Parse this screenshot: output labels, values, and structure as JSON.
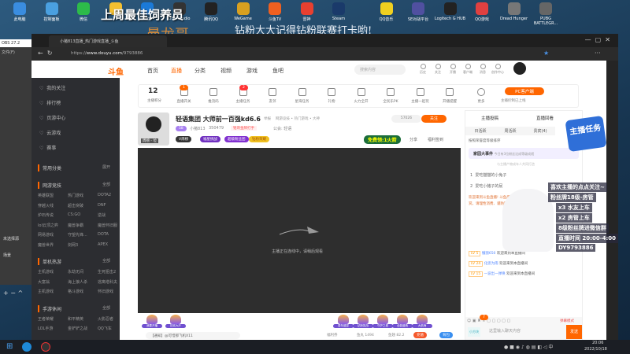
{
  "desktop": {
    "icons": [
      "此电脑",
      "控制面板",
      "微信",
      "YY",
      "Edge",
      "OBS Studio",
      "腾讯QQ",
      "WeGame",
      "斗鱼TV",
      "雷神",
      "Steam",
      "QQ音乐",
      "SE对战平台",
      "Logitech G HUB",
      "QQ游戏",
      "Dread Hunger",
      "PUBG BATTLEGR..."
    ]
  },
  "overlay": {
    "best_feeder": "上周最佳饲养员",
    "name": "曼龙哥",
    "reminder": "钻粉大大记得钻粉联赛打卡哟!"
  },
  "obs": {
    "title": "OBS 27.2",
    "menu": "文件(F)",
    "source_label": "未选择源",
    "scene_label": "场景"
  },
  "browser": {
    "tab_title": "小猪813直播_热门游戏直播_斗鱼",
    "url_prefix": "https://",
    "url_domain": "www.douyu.com",
    "url_path": "/9793886"
  },
  "header": {
    "nav": [
      "首页",
      "直播",
      "分类",
      "视频",
      "游戏",
      "鱼吧"
    ],
    "search_placeholder": "搜索内容",
    "icons": [
      "历史",
      "关注",
      "开播",
      "客户端",
      "消息",
      "创作中心"
    ]
  },
  "sidebar": {
    "items": [
      "我的关注",
      "排行榜",
      "页游中心",
      "云游戏",
      "赛事"
    ],
    "sections": [
      {
        "title": "常用分类",
        "more": "展开",
        "games": []
      },
      {
        "title": "网游竞技",
        "more": "全部",
        "games": [
          "英雄联盟",
          "热门游戏",
          "DOTA2",
          "穿越火线",
          "超击突破",
          "DNF",
          "炉石传说",
          "CS:GO",
          "逆战",
          "lol云顶之弈",
          "魔兽争霸",
          "魔兽怀旧服",
          "网易游戏",
          "守望先锋...",
          "DOTA",
          "魔兽世界",
          "剑网3",
          "APEX"
        ]
      },
      {
        "title": "单机热游",
        "more": "全部",
        "games": [
          "主机游戏",
          "永劫无间",
          "生死狙击2",
          "大富翁",
          "海上狼人杀",
          "逃离塔科夫",
          "主机游戏",
          "格斗游戏",
          "怀旧游戏"
        ]
      },
      {
        "title": "手游休闲",
        "more": "全部",
        "games": [
          "王者荣耀",
          "和平精英",
          "火影忍者",
          "LOL手游",
          "金铲铲之战",
          "QQ飞车"
        ]
      }
    ]
  },
  "toolbar": {
    "score": "12",
    "items": [
      "主播积分",
      "直播开关",
      "推流码",
      "主播任务",
      "友邻",
      "星海任务",
      "礼物",
      "火力全开",
      "全民乐PK",
      "主播一起玩",
      "开播提醒",
      "更多"
    ],
    "badges": {
      "live_switch": "1",
      "task": "2"
    },
    "pc_button": "PC客户端",
    "pc_sub": "主播控制已上线"
  },
  "streamer": {
    "title": "轻语集团 大师前一百强kd6.6",
    "report": "举报",
    "category": "网游竞技 • 热门游戏 • 大神",
    "level": "58",
    "name": "小猪813",
    "heat": "350479",
    "medal": "铭哥金牌打手",
    "guild": "公会: 轻语",
    "follow_count": "57026",
    "follow_label": "关注",
    "tags": [
      "V周榜",
      "福星挑战",
      "超级粉丝团",
      "钻粉荣耀"
    ],
    "free_gift": "免费领:1火箭",
    "share": "分享",
    "signin": "福利签到",
    "avatar_label": "周榜 - 位"
  },
  "video": {
    "loading_text": "主播正在连线中，请稍后观看"
  },
  "below": {
    "gifts": [
      "我要开播",
      "狂欢大厅",
      "周年盛宴",
      "钻粉挑战",
      "守护之城",
      "全能盛典",
      "大航海"
    ],
    "notice": "【通知】@可惜那飞机X11",
    "welfare": "福利券",
    "fishball": "鱼丸 1494",
    "fishwing": "鱼翅 82.2",
    "recharge": "充值",
    "backpack": "背包"
  },
  "chat": {
    "tabs_top": [
      "主播投稿",
      "直播回看"
    ],
    "tabs": [
      "日活跃",
      "周活跃",
      "贵宾(4)",
      "钻粉"
    ],
    "hint": "按照荣誉度等级排序",
    "event": "家园大事件",
    "event_sub": "今日有3位粉丝达成等级成就",
    "rank_hint": "与主播产物成年人共同打造",
    "ranks": [
      {
        "n": "1",
        "name": "爱吃猫猫的小兔子"
      },
      {
        "n": "2",
        "name": "爱吃小猪子的屁"
      }
    ],
    "system": "欢迎来到斗鱼直播! 斗鱼严禁未成年人直播或打赏。请理性消费、谨防网络诈骗。",
    "messages": [
      {
        "lv": "LV 5",
        "user": "懂丽650",
        "text": "欢迎来到本直播间"
      },
      {
        "lv": "LV 24",
        "user": "化思为雨",
        "text": "欢迎来到本直播间"
      },
      {
        "lv": "LV 15",
        "user": "一波出一弹唤",
        "text": "欢迎来到本直播间"
      }
    ],
    "input_placeholder": "这里输入聊天内容",
    "send": "发送",
    "mini": "小方块",
    "badge": "7",
    "barrage": "弹幕模式"
  },
  "stream_overlay": [
    "喜欢主播的点点关注~",
    "粉丝牌18级-房管",
    "x3 水友上车",
    "x2 房管上车",
    "8级粉丝牌进微信群",
    "直播时间 20:00-4:00",
    "DY9793886"
  ],
  "task_badge": "主播任务",
  "taskbar": {
    "time": "20:06",
    "date": "2022/10/18"
  }
}
